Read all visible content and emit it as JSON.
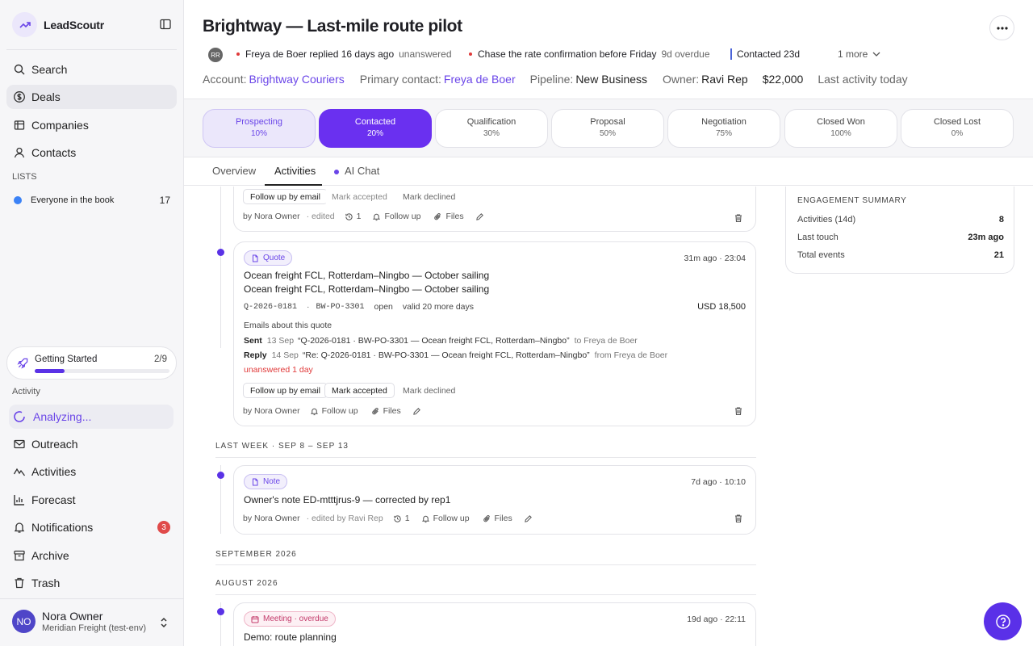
{
  "brand": {
    "name": "LeadScoutr"
  },
  "nav": {
    "search": "Search",
    "deals": "Deals",
    "companies": "Companies",
    "contacts": "Contacts"
  },
  "lists": {
    "heading": "LISTS",
    "items": [
      {
        "label": "Everyone in the book",
        "count": "17",
        "color": "#3b82f6"
      }
    ]
  },
  "getting_started": {
    "label": "Getting Started",
    "count": "2/9",
    "progress": 0.22
  },
  "activity_section": {
    "heading": "Activity",
    "analyzing": "Analyzing..."
  },
  "nav2": {
    "outreach": "Outreach",
    "activities": "Activities",
    "forecast": "Forecast",
    "notifications": "Notifications",
    "notifications_count": "3",
    "archive": "Archive",
    "trash": "Trash"
  },
  "user": {
    "initials": "NO",
    "name": "Nora Owner",
    "org": "Meridian Freight (test-env)"
  },
  "deal": {
    "title": "Brightway — Last-mile route pilot",
    "avatar_initials": "RR",
    "alert1": "Freya de Boer replied 16 days ago",
    "alert1_status": "unanswered",
    "alert2": "Chase the rate confirmation before Friday",
    "alert2_status": "9d overdue",
    "contacted": "Contacted 23d",
    "more": "1 more",
    "account_label": "Account:",
    "account": "Brightway Couriers",
    "contact_label": "Primary contact:",
    "contact": "Freya de Boer",
    "pipeline_label": "Pipeline:",
    "pipeline": "New Business",
    "owner_label": "Owner:",
    "owner": "Ravi Rep",
    "amount": "$22,000",
    "last_activity": "Last activity today"
  },
  "stages": [
    {
      "name": "Prospecting",
      "pct": "10%"
    },
    {
      "name": "Contacted",
      "pct": "20%"
    },
    {
      "name": "Qualification",
      "pct": "30%"
    },
    {
      "name": "Proposal",
      "pct": "50%"
    },
    {
      "name": "Negotiation",
      "pct": "75%"
    },
    {
      "name": "Closed Won",
      "pct": "100%"
    },
    {
      "name": "Closed Lost",
      "pct": "0%"
    }
  ],
  "tabs": {
    "overview": "Overview",
    "activities": "Activities",
    "ai_chat": "AI Chat"
  },
  "feed": {
    "card0": {
      "btn_follow": "Follow up by email",
      "btn_accept": "Mark accepted",
      "btn_decline": "Mark declined",
      "by": "by Nora Owner",
      "edited": "· edited",
      "history": "1",
      "followup": "Follow up",
      "files": "Files"
    },
    "quote": {
      "chip": "Quote",
      "time": "31m ago · 23:04",
      "title": "Ocean freight FCL, Rotterdam–Ningbo — October sailing",
      "subtitle": "Ocean freight FCL, Rotterdam–Ningbo — October sailing",
      "ref1": "Q-2026-0181",
      "dot": "·",
      "ref2": "BW-PO-3301",
      "status": "open",
      "validity": "valid 20 more days",
      "amount": "USD 18,500",
      "emails_heading": "Emails about this quote",
      "sent_label": "Sent",
      "sent_date": "13 Sep",
      "sent_subject": "“Q-2026-0181 · BW-PO-3301 — Ocean freight FCL, Rotterdam–Ningbo”",
      "sent_to": "to Freya de Boer",
      "reply_label": "Reply",
      "reply_date": "14 Sep",
      "reply_subject": "“Re: Q-2026-0181 · BW-PO-3301 — Ocean freight FCL, Rotterdam–Ningbo”",
      "reply_from": "from Freya de Boer",
      "unanswered": "unanswered 1 day",
      "btn_follow": "Follow up by email",
      "btn_accept": "Mark accepted",
      "btn_decline": "Mark declined",
      "by": "by Nora Owner",
      "followup": "Follow up",
      "files": "Files"
    },
    "group_last_week": "LAST WEEK · SEP 8 – SEP 13",
    "note": {
      "chip": "Note",
      "time": "7d ago · 10:10",
      "title": "Owner's note ED-mtttjrus-9 — corrected by rep1",
      "by": "by Nora Owner",
      "edited": "· edited by Ravi Rep",
      "history": "1",
      "followup": "Follow up",
      "files": "Files"
    },
    "group_sep": "SEPTEMBER 2026",
    "group_aug": "AUGUST 2026",
    "meeting": {
      "chip": "Meeting",
      "chip_status": "· overdue",
      "time": "19d ago · 22:11",
      "title": "Demo: route planning"
    }
  },
  "summary": {
    "heading": "ENGAGEMENT SUMMARY",
    "rows": [
      {
        "label": "Activities (14d)",
        "value": "8"
      },
      {
        "label": "Last touch",
        "value": "23m ago"
      },
      {
        "label": "Total events",
        "value": "21"
      }
    ]
  },
  "colors": {
    "accent": "#6a30f0",
    "alert": "#e03a3a",
    "badge": "#e04a4a"
  }
}
